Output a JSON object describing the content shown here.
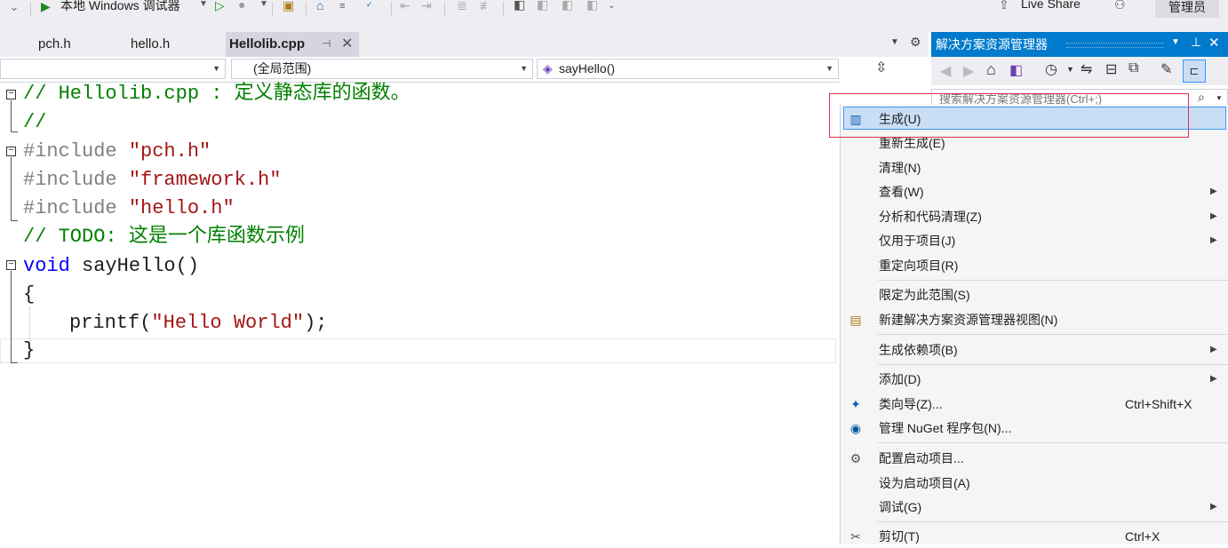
{
  "toolbar": {
    "debugger_label": "本地 Windows 调试器",
    "live_share": "Live Share",
    "admin_badge": "管理员"
  },
  "tabs": [
    {
      "label": "pch.h"
    },
    {
      "label": "hello.h"
    },
    {
      "label": "Hellolib.cpp"
    }
  ],
  "navbar": {
    "scope": "(全局范围)",
    "member": "sayHello()"
  },
  "code_lines": {
    "l1_comment": "// Hellolib.cpp : 定义静态库的函数。",
    "l2_comment": "//",
    "l3_directive": "#include",
    "l3_string": "\"pch.h\"",
    "l4_directive": "#include",
    "l4_string": "\"framework.h\"",
    "l5_directive": "#include",
    "l5_string": "\"hello.h\"",
    "l6_comment": "// TODO: 这是一个库函数示例",
    "l7_keyword": "void",
    "l7_rest": " sayHello()",
    "l8_brace": "{",
    "l9_func": "printf(",
    "l9_string": "\"Hello World\"",
    "l9_end": ");",
    "l10_brace": "}"
  },
  "solution_explorer": {
    "title": "解决方案资源管理器",
    "search_placeholder": "搜索解决方案资源管理器(Ctrl+;)"
  },
  "context_menu": {
    "items": [
      {
        "label": "生成(U)",
        "icon": "build-icon",
        "highlighted": true
      },
      {
        "label": "重新生成(E)"
      },
      {
        "label": "清理(N)"
      },
      {
        "label": "查看(W)",
        "submenu": true
      },
      {
        "label": "分析和代码清理(Z)",
        "submenu": true
      },
      {
        "label": "仅用于项目(J)",
        "submenu": true
      },
      {
        "label": "重定向项目(R)"
      },
      {
        "label": "限定为此范围(S)"
      },
      {
        "label": "新建解决方案资源管理器视图(N)",
        "icon": "new-view-icon"
      },
      {
        "label": "生成依赖项(B)",
        "submenu": true
      },
      {
        "label": "添加(D)",
        "submenu": true
      },
      {
        "label": "类向导(Z)...",
        "shortcut": "Ctrl+Shift+X",
        "icon": "class-wizard-icon"
      },
      {
        "label": "管理 NuGet 程序包(N)...",
        "icon": "nuget-icon"
      },
      {
        "label": "配置启动项目...",
        "icon": "gear-icon"
      },
      {
        "label": "设为启动项目(A)"
      },
      {
        "label": "调试(G)",
        "submenu": true
      },
      {
        "label": "剪切(T)",
        "shortcut": "Ctrl+X",
        "icon": "scissors-icon"
      }
    ]
  },
  "colors": {
    "accent": "#007acc",
    "highlight": "#c9def5",
    "annotation_box": "#e0304a",
    "comment": "#008000",
    "keyword": "#0000ff",
    "string": "#a31515"
  }
}
